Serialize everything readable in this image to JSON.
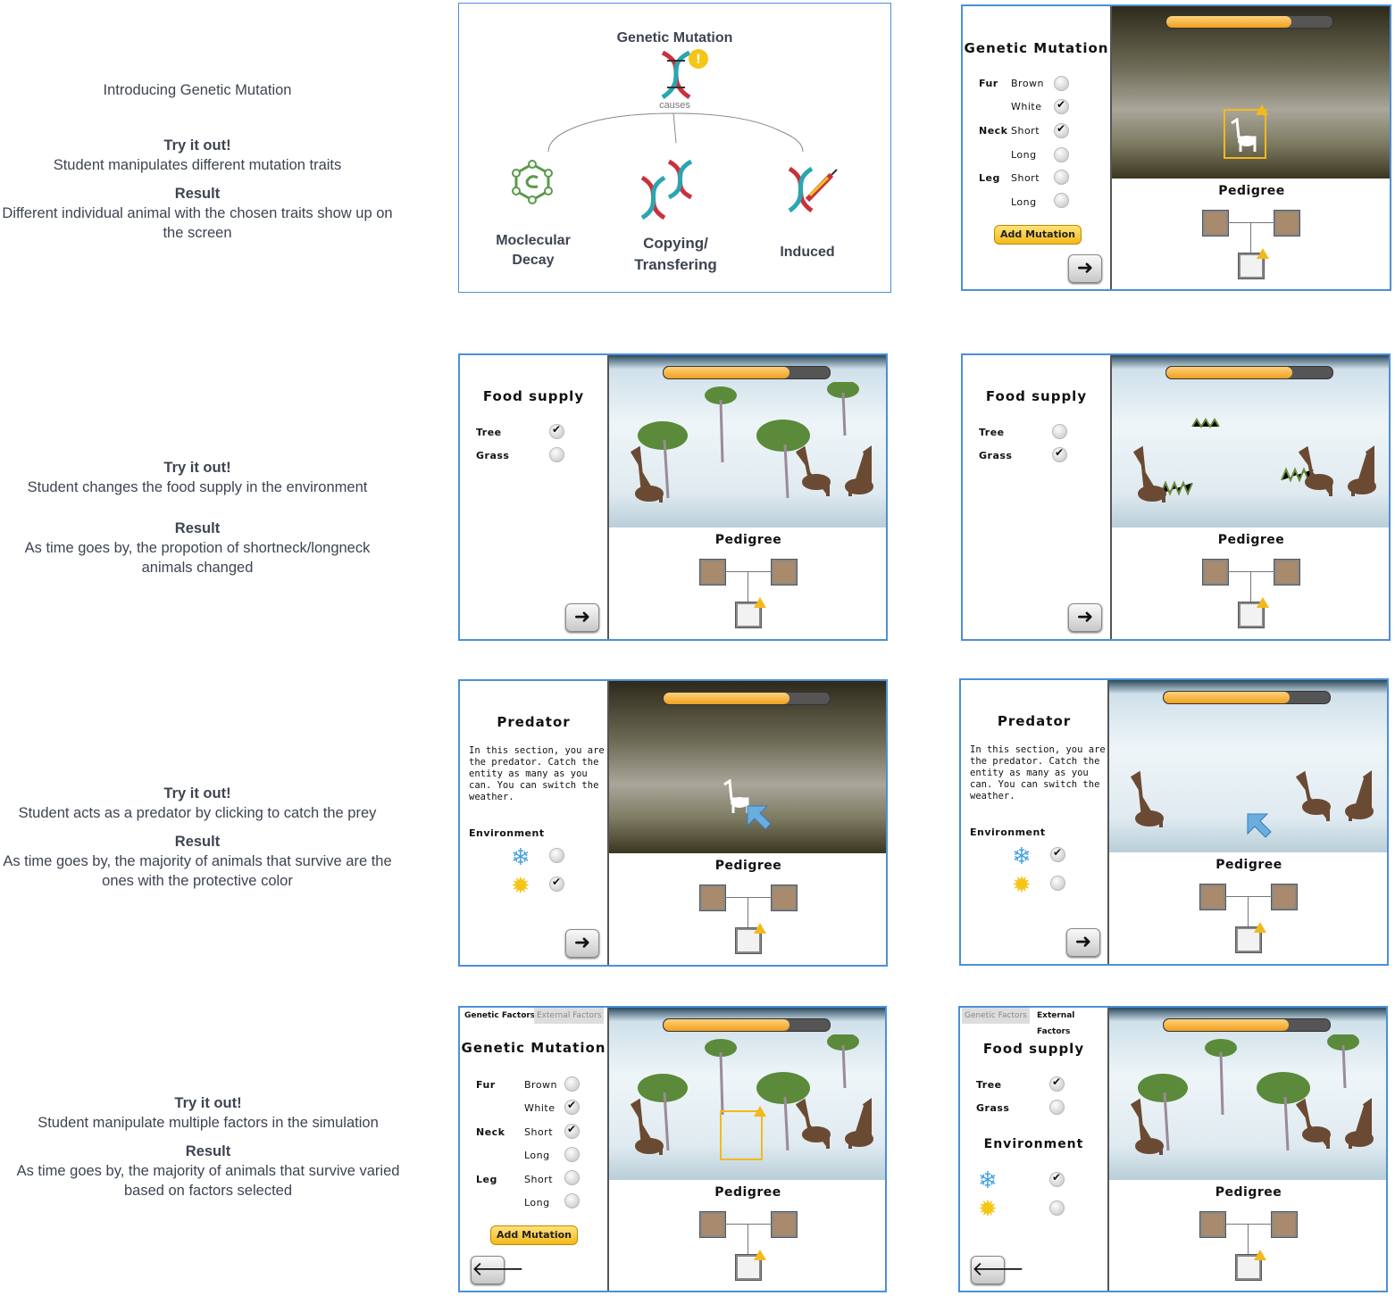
{
  "rows": [
    {
      "intro": "Introducing Genetic Mutation",
      "try": "Try it out!",
      "try_text": "Student manipulates different mutation traits",
      "result": "Result",
      "result_text": "Different individual animal with the chosen traits show up on the screen"
    },
    {
      "try": "Try it out!",
      "try_text": "Student changes the food supply in the environment",
      "result": "Result",
      "result_text": "As time goes by, the propotion of shortneck/longneck animals changed"
    },
    {
      "try": "Try it out!",
      "try_text": "Student acts as a predator by clicking to catch the prey",
      "result": "Result",
      "result_text": "As time goes by, the majority of animals that survive are the ones with the protective color"
    },
    {
      "try": "Try it out!",
      "try_text": "Student manipulate multiple factors in the simulation",
      "result": "Result",
      "result_text": "As time goes by, the majority of animals that survive varied based on factors selected"
    }
  ],
  "concept": {
    "title": "Genetic Mutation",
    "causes": "causes",
    "items": [
      "Moclecular\nDecay",
      "Copying/\nTransfering",
      "Induced"
    ],
    "colors": {
      "red": "#c8323c",
      "teal": "#2aa6b0",
      "green": "#5a9a4a",
      "yellow": "#f5c518"
    }
  },
  "mutation": {
    "title": "Genetic Mutation",
    "fur_label": "Fur",
    "neck_label": "Neck",
    "leg_label": "Leg",
    "brown": "Brown",
    "white": "White",
    "short": "Short",
    "long": "Long",
    "add_button": "Add Mutation"
  },
  "food": {
    "title": "Food supply",
    "tree": "Tree",
    "grass": "Grass"
  },
  "predator": {
    "title": "Predator",
    "blurb": "In this section, you are\nthe predator. Catch the\nentity as many as you\ncan. You can switch the\nweather.",
    "env": "Environment"
  },
  "tabs": {
    "genetic": "Genetic Factors",
    "external": "External Factors"
  },
  "pedigree": "Pedigree",
  "environment": "Environment",
  "icons": {
    "next": "arrow-right-icon",
    "back": "arrow-left-icon",
    "snow": "snowflake-icon",
    "sun": "sun-icon",
    "warn": "warning-icon",
    "check": "check-icon"
  },
  "progress": [
    0.75,
    0.65,
    0.75,
    0.75,
    0.65,
    0.75,
    0.72,
    0.73
  ]
}
